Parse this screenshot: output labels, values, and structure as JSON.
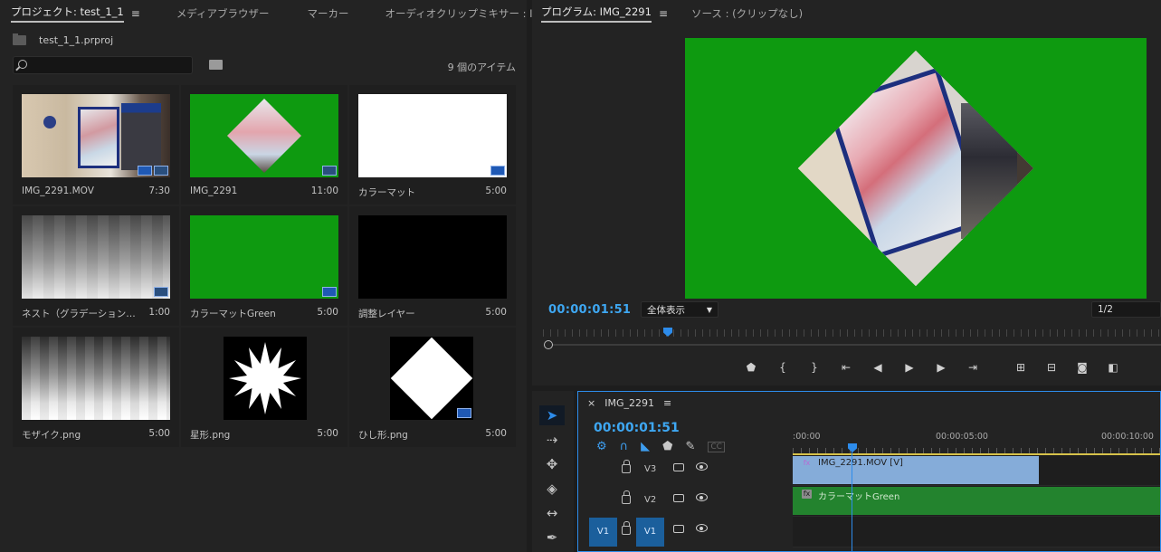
{
  "project_panel": {
    "tabs": [
      {
        "label": "プロジェクト: test_1_1",
        "active": true
      },
      {
        "label": "メディアブラウザー",
        "active": false
      },
      {
        "label": "マーカー",
        "active": false
      },
      {
        "label": "オーディオクリップミキサー : IM",
        "active": false
      }
    ],
    "overflow_icon": "»",
    "menu_icon": "≡",
    "project_file": "test_1_1.prproj",
    "search": {
      "value": "",
      "placeholder": ""
    },
    "item_count": "9 個のアイテム",
    "items": [
      {
        "name": "IMG_2291.MOV",
        "duration": "7:30",
        "thumb": "photo"
      },
      {
        "name": "IMG_2291",
        "duration": "11:00",
        "thumb": "diamond-photo"
      },
      {
        "name": "カラーマット",
        "duration": "5:00",
        "thumb": "white"
      },
      {
        "name": "ネスト（グラデーション…",
        "duration": "1:00",
        "thumb": "gradient"
      },
      {
        "name": "カラーマットGreen",
        "duration": "5:00",
        "thumb": "green"
      },
      {
        "name": "調整レイヤー",
        "duration": "5:00",
        "thumb": "black"
      },
      {
        "name": "モザイク.png",
        "duration": "5:00",
        "thumb": "mosaic"
      },
      {
        "name": "星形.png",
        "duration": "5:00",
        "thumb": "star"
      },
      {
        "name": "ひし形.png",
        "duration": "5:00",
        "thumb": "diamond"
      }
    ]
  },
  "program_panel": {
    "tabs": [
      {
        "label": "プログラム: IMG_2291",
        "active": true
      },
      {
        "label": "ソース : (クリップなし)",
        "active": false
      }
    ],
    "menu_icon": "≡",
    "timecode": "00:00:01:51",
    "zoom_select": "全体表示",
    "resolution_select": "1/2",
    "transport_icons": [
      "marker-icon",
      "mark-in-icon",
      "mark-out-icon",
      "go-to-in-icon",
      "step-back-icon",
      "play-icon",
      "step-forward-icon",
      "go-to-out-icon",
      "lift-icon",
      "extract-icon",
      "export-frame-icon",
      "compare-view-icon"
    ]
  },
  "tools": [
    "selection-tool-icon",
    "track-select-forward-icon",
    "ripple-edit-icon",
    "razor-icon",
    "slip-icon",
    "pen-icon"
  ],
  "timeline": {
    "title": "IMG_2291",
    "close": "×",
    "menu_icon": "≡",
    "timecode": "00:00:01:51",
    "ruler": [
      ":00:00",
      "00:00:05:00",
      "00:00:10:00"
    ],
    "cc_label": "CC",
    "tracks": [
      {
        "label": "V3",
        "clip": "IMG_2291.MOV [V]",
        "clip_type": "video",
        "fx": "fx"
      },
      {
        "label": "V2",
        "clip": "カラーマットGreen",
        "clip_type": "matte",
        "fx": "fx"
      },
      {
        "label": "V1",
        "source_patch": "V1",
        "clip": ""
      }
    ],
    "colors": {
      "accent": "#2d8ceb",
      "video_clip": "#85acd9",
      "matte_clip": "#23832e",
      "green_screen": "#0e9a10"
    }
  }
}
